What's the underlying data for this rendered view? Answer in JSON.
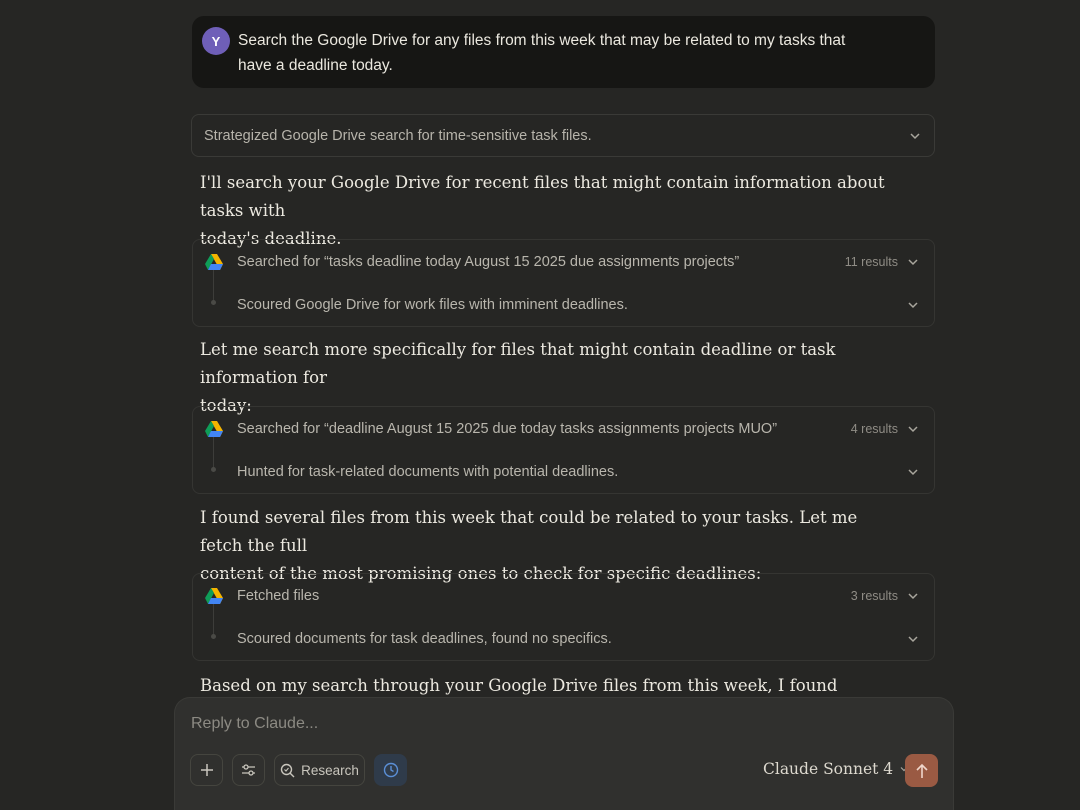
{
  "user_message": {
    "avatar_letter": "Y",
    "text_line1": "Search the Google Drive for any files from this week that may be related to my tasks that",
    "text_line2": "have a deadline today."
  },
  "thinking_summary": "Strategized Google Drive search for time-sensitive task files.",
  "paragraphs": [
    {
      "line1": "I'll search your Google Drive for recent files that might contain information about tasks with",
      "line2": "today's deadline."
    },
    {
      "line1": "Let me search more specifically for files that might contain deadline or task information for",
      "line2": "today:"
    },
    {
      "line1": "I found several files from this week that could be related to your tasks. Let me fetch the full",
      "line2": "content of the most promising ones to check for specific deadlines:"
    },
    {
      "line1": "Based on my search through your Google Drive files from this week, I found several work-"
    }
  ],
  "tool_calls": [
    {
      "title": "Searched for “tasks deadline today August 15 2025 due assignments projects”",
      "count": "11 results",
      "summary": "Scoured Google Drive for work files with imminent deadlines."
    },
    {
      "title": "Searched for “deadline August 15 2025 due today tasks assignments projects MUO”",
      "count": "4 results",
      "summary": "Hunted for task-related documents with potential deadlines."
    },
    {
      "title": "Fetched files",
      "count": "3 results",
      "summary": "Scoured documents for task deadlines, found no specifics."
    }
  ],
  "composer": {
    "placeholder": "Reply to Claude...",
    "research_label": "Research",
    "model_name": "Claude Sonnet 4"
  },
  "icons": {
    "tool_icon": "google-drive-icon",
    "add": "plus-icon",
    "tools": "sliders-icon",
    "research": "search-icon",
    "extended": "clock-icon",
    "send": "arrow-up-icon"
  },
  "colors": {
    "background": "#262624",
    "user_bubble": "#161614",
    "avatar": "#6f5fb8",
    "send_button": "#9a5a43"
  }
}
